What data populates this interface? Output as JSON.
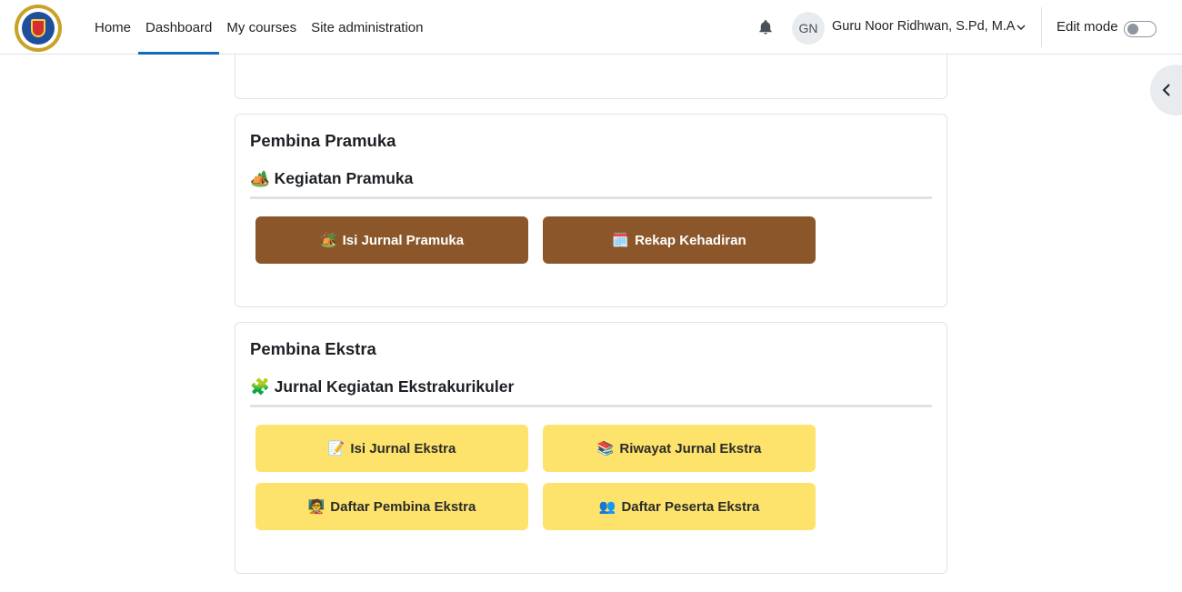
{
  "navbar": {
    "links": [
      {
        "label": "Home"
      },
      {
        "label": "Dashboard"
      },
      {
        "label": "My courses"
      },
      {
        "label": "Site administration"
      }
    ],
    "active_link": "Dashboard",
    "avatar_initials": "GN",
    "user_name": "Guru Noor Ridhwan, S.Pd, M.A",
    "edit_mode_label": "Edit mode",
    "edit_mode_on": false,
    "accent_color": "#0f6cbf"
  },
  "icons": {
    "notifications": "bell-icon",
    "user_menu": "chevron-down-icon",
    "drawer": "chevron-left-icon"
  },
  "pramuka": {
    "title": "Pembina Pramuka",
    "section_emoji": "🏕️",
    "section_title": "Kegiatan Pramuka",
    "buttons": [
      {
        "emoji": "🏕️",
        "label": "Isi Jurnal Pramuka"
      },
      {
        "emoji": "🗓️",
        "label": "Rekap Kehadiran"
      }
    ],
    "button_color": "#8b572a"
  },
  "ekstra": {
    "title": "Pembina Ekstra",
    "section_emoji": "🧩",
    "section_title": "Jurnal Kegiatan Ekstrakurikuler",
    "buttons": [
      {
        "emoji": "📝",
        "label": "Isi Jurnal Ekstra"
      },
      {
        "emoji": "📚",
        "label": "Riwayat Jurnal Ekstra"
      },
      {
        "emoji": "🧑‍🏫",
        "label": "Daftar Pembina Ekstra"
      },
      {
        "emoji": "👥",
        "label": "Daftar Peserta Ekstra"
      }
    ],
    "button_color": "#fde36b"
  }
}
